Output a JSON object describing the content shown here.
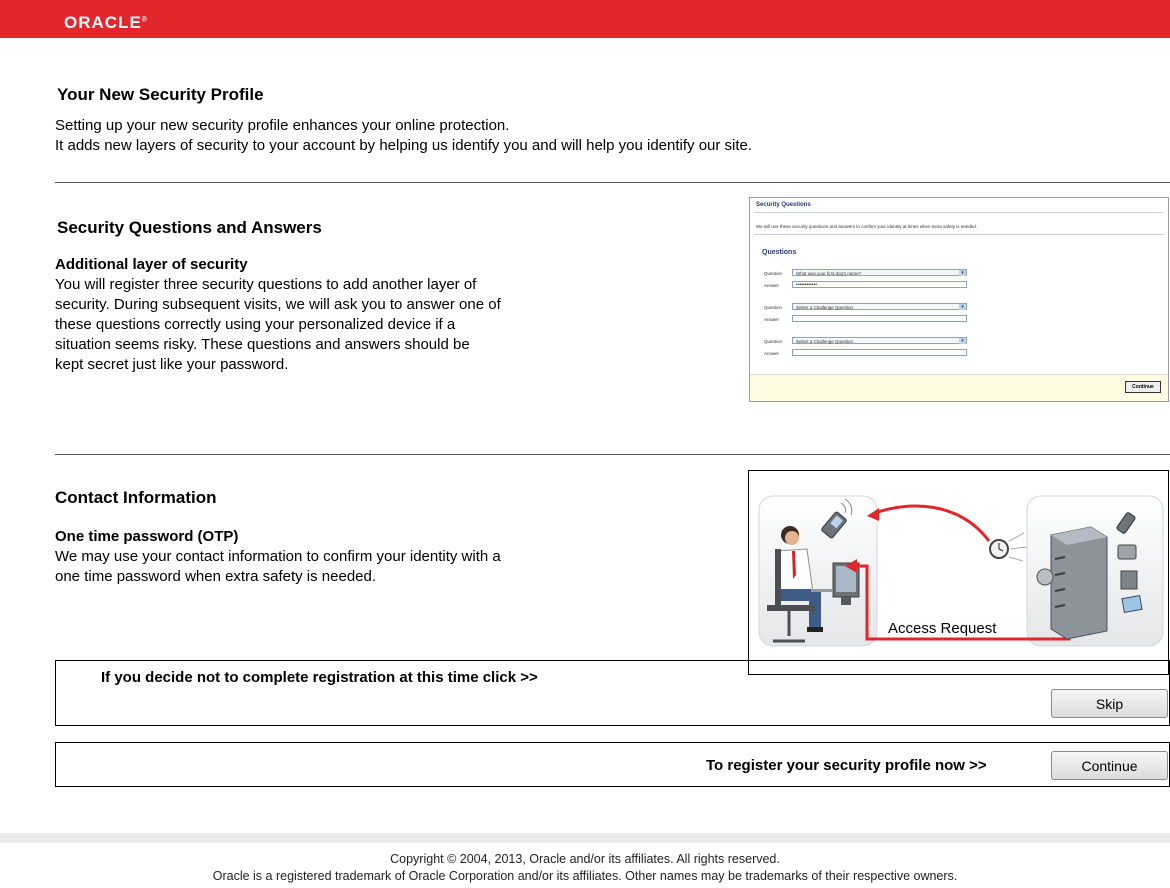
{
  "header": {
    "brand": "ORACLE",
    "brand_mark": "®"
  },
  "page": {
    "title": "Your New Security Profile",
    "intro_line1": "Setting up your new security profile enhances your online protection.",
    "intro_line2": "It adds new layers of security to your account by helping us identify you and will help you identify our site."
  },
  "questions_section": {
    "heading": "Security Questions and Answers",
    "subheading": "Additional layer of security",
    "lines": [
      "You will register three security questions to add another layer of",
      "security. During subsequent visits, we will ask you to answer one of",
      "these questions correctly using your personalized device if a",
      "situation seems risky. These questions and answers should be",
      "kept secret just like your password."
    ]
  },
  "thumbnail": {
    "title": "Security Questions",
    "description": "We will use these security questions and answers to confirm your identity at times when extra safety is needed.",
    "questions_heading": "Questions",
    "question_label": "Question",
    "answer_label": "Answer",
    "q1_selected": "What was your first dog's name?",
    "q1_answer": "••••••••••••",
    "q2_selected": "Select a Challenge Question",
    "q3_selected": "Select a Challenge Question",
    "continue_label": "Continue"
  },
  "contact_section": {
    "heading": "Contact Information",
    "subheading": "One time password (OTP)",
    "lines": [
      "We may use your contact information to confirm your identity with a",
      "one time password when extra safety is needed."
    ]
  },
  "diagram": {
    "label": "Access Request"
  },
  "skip_row": {
    "text": "If you decide not to complete registration at this time click >>",
    "button_label": "Skip"
  },
  "continue_row": {
    "text": "To register your security profile now >>",
    "button_label": "Continue"
  },
  "footer": {
    "copyright": "Copyright © 2004, 2013, Oracle and/or its affiliates. All rights reserved.",
    "trademark": "Oracle is a registered trademark of Oracle Corporation and/or its affiliates. Other names may be trademarks of their respective owners."
  },
  "colors": {
    "brand_red": "#e3262b",
    "accent_red": "#e0262b"
  }
}
